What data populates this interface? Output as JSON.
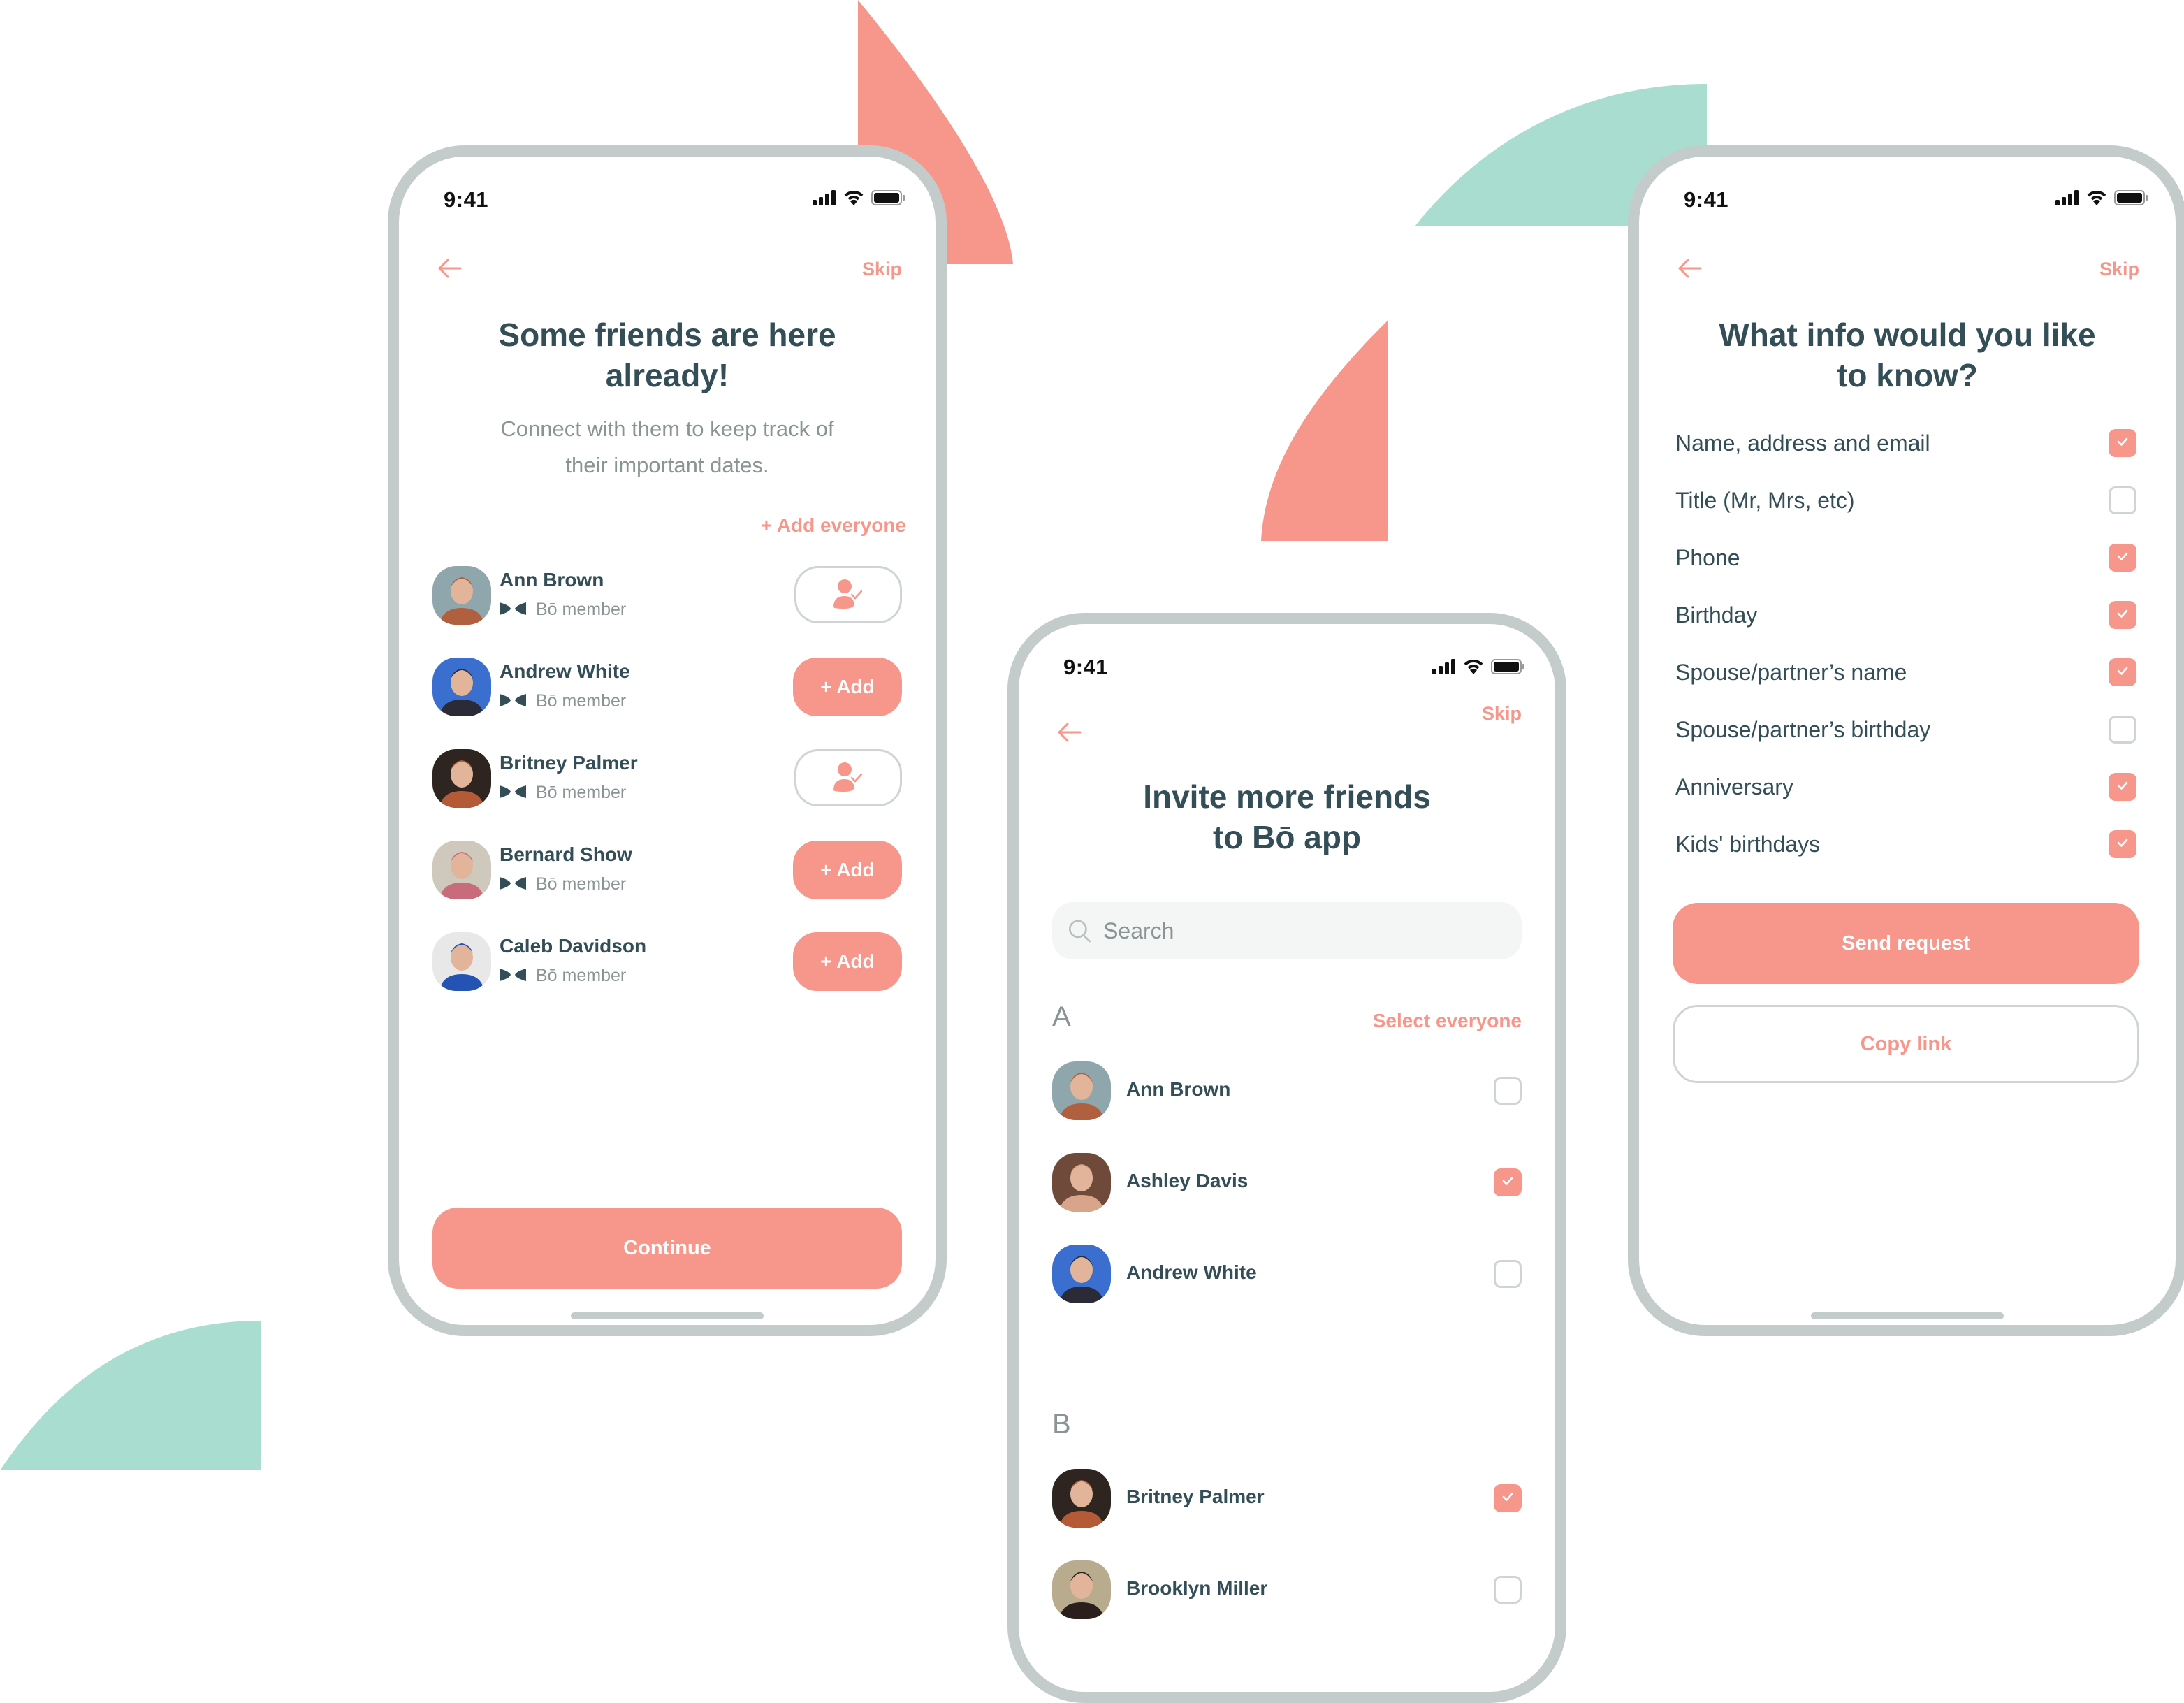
{
  "colors": {
    "accent": "#f7968a",
    "teal_shape": "#a9ddd0",
    "heading": "#334e57",
    "muted": "#8a9494",
    "frame": "#c3cbcb"
  },
  "screen_friends_here": {
    "status_time": "9:41",
    "back_icon": "arrow-left-icon",
    "skip_label": "Skip",
    "title_line1": "Some friends are here",
    "title_line2": "already!",
    "subtitle_line1": "Connect with them to keep track of",
    "subtitle_line2": "their important dates.",
    "add_everyone_label": "+ Add everyone",
    "members": [
      {
        "name": "Ann Brown",
        "badge": "Bō member",
        "status": "added",
        "avatar_colors": [
          "#8fa6ad",
          "#b0603e"
        ]
      },
      {
        "name": "Andrew White",
        "badge": "Bō member",
        "status": "add",
        "action_label": "+ Add",
        "avatar_colors": [
          "#3a6fd0",
          "#2b2b38"
        ]
      },
      {
        "name": "Britney Palmer",
        "badge": "Bō member",
        "status": "added",
        "avatar_colors": [
          "#2e2420",
          "#b55a36"
        ]
      },
      {
        "name": "Bernard Show",
        "badge": "Bō member",
        "status": "add",
        "action_label": "+ Add",
        "avatar_colors": [
          "#cfc8bd",
          "#c86b7a"
        ]
      },
      {
        "name": "Caleb Davidson",
        "badge": "Bō member",
        "status": "add",
        "action_label": "+ Add",
        "avatar_colors": [
          "#e8e8e8",
          "#2453b4"
        ]
      }
    ],
    "continue_label": "Continue"
  },
  "screen_invite": {
    "status_time": "9:41",
    "skip_label": "Skip",
    "title_line1": "Invite more friends",
    "title_line2": "to Bō app",
    "search_placeholder": "Search",
    "select_everyone_label": "Select everyone",
    "sections": [
      {
        "letter": "A",
        "contacts": [
          {
            "name": "Ann Brown",
            "checked": false,
            "avatar_colors": [
              "#8fa6ad",
              "#b0603e"
            ]
          },
          {
            "name": "Ashley Davis",
            "checked": true,
            "avatar_colors": [
              "#6f4a3b",
              "#d8a48a"
            ]
          },
          {
            "name": "Andrew White",
            "checked": false,
            "avatar_colors": [
              "#3a6fd0",
              "#2b2b38"
            ]
          }
        ]
      },
      {
        "letter": "B",
        "contacts": [
          {
            "name": "Britney Palmer",
            "checked": true,
            "avatar_colors": [
              "#2e2420",
              "#b55a36"
            ]
          },
          {
            "name": "Brooklyn Miller",
            "checked": false,
            "avatar_colors": [
              "#b9ac8e",
              "#2a1f1c"
            ]
          }
        ]
      }
    ]
  },
  "screen_info": {
    "status_time": "9:41",
    "skip_label": "Skip",
    "title_line1": "What info would you like",
    "title_line2": "to know?",
    "options": [
      {
        "label": "Name, address and email",
        "checked": true
      },
      {
        "label": "Title (Mr, Mrs, etc)",
        "checked": false
      },
      {
        "label": "Phone",
        "checked": true
      },
      {
        "label": "Birthday",
        "checked": true
      },
      {
        "label": "Spouse/partner’s name",
        "checked": true
      },
      {
        "label": "Spouse/partner’s birthday",
        "checked": false
      },
      {
        "label": "Anniversary",
        "checked": true
      },
      {
        "label": "Kids' birthdays",
        "checked": true
      }
    ],
    "send_request_label": "Send request",
    "copy_link_label": "Copy link"
  }
}
